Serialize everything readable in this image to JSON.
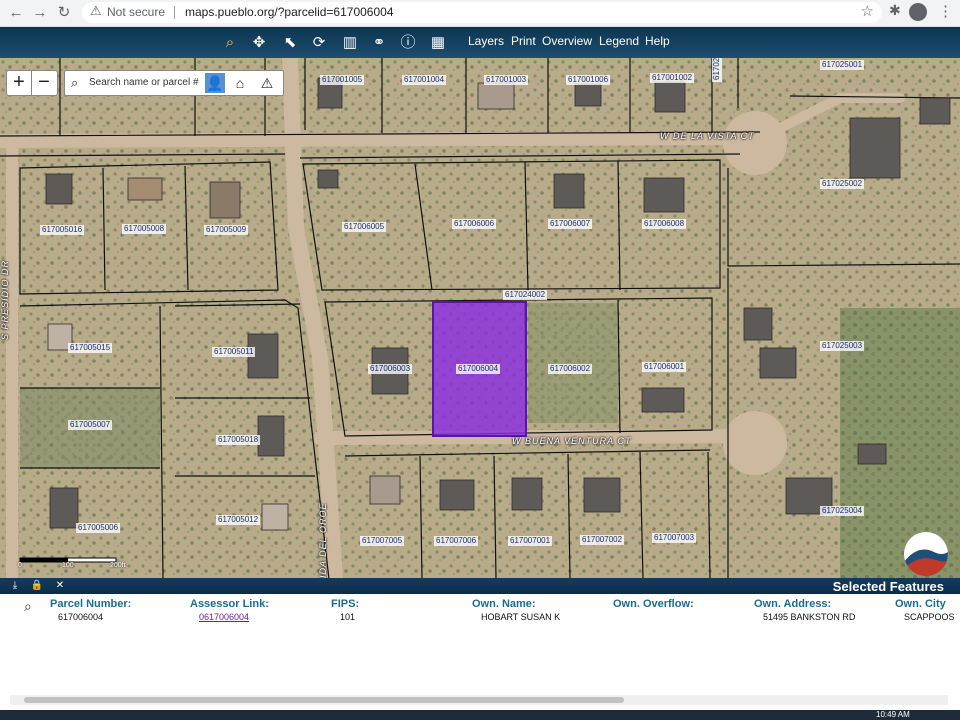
{
  "browser": {
    "security_label": "Not secure",
    "url": "maps.pueblo.org/?parcelid=617006004"
  },
  "toolbar": {
    "menu": [
      "Layers",
      "Print",
      "Overview",
      "Legend",
      "Help"
    ]
  },
  "map": {
    "search_placeholder": "Search name or parcel #",
    "zoom_in": "+",
    "zoom_out": "−",
    "streets": {
      "de_la_vista": "W DE LA VISTA CT",
      "buena_ventura": "W BUENA VENTURA CT",
      "presidio": "S PRESIDIO DR",
      "oroe": "IDA DEL OROE"
    },
    "parcels": [
      "617001005",
      "617001004",
      "617001003",
      "617001006",
      "617001002",
      "617024002",
      "617025001",
      "617025002",
      "617005016",
      "617005008",
      "617005009",
      "617006005",
      "617006006",
      "617006007",
      "617006008",
      "617024002",
      "617005015",
      "617005011",
      "617006003",
      "617006004",
      "617006002",
      "617006001",
      "617025003",
      "617005007",
      "617005018",
      "617005006",
      "617005012",
      "617007005",
      "617007006",
      "617007001",
      "617007002",
      "617007003",
      "617025004"
    ],
    "scale": [
      "0",
      "100",
      "200ft"
    ],
    "selected_parcel_color": "#8a2be2"
  },
  "panel": {
    "title": "Selected Features",
    "headers": [
      "Parcel Number:",
      "Assessor Link:",
      "FIPS:",
      "Own. Name:",
      "Own. Overflow:",
      "Own. Address:",
      "Own. City"
    ],
    "row": [
      "617006004",
      "0617006004",
      "101",
      "HOBART SUSAN K",
      "",
      "51495 BANKSTON RD",
      "SCAPPOOS"
    ]
  },
  "taskbar": {
    "clock": "10:49 AM"
  }
}
